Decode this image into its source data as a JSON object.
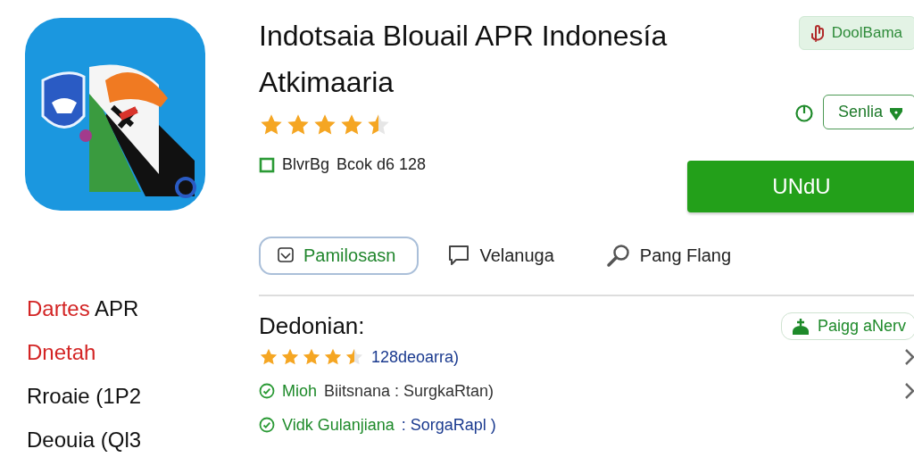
{
  "app": {
    "title": "Indotsaia Blouail APR Indonesía Atkimaaria",
    "stars": 4.5,
    "meta_label": "BlvrBg",
    "meta_value": "Bcok d6 128"
  },
  "badge": {
    "label": "DoolBama"
  },
  "secondary_button": {
    "label": "Senlia"
  },
  "primary_button": {
    "label": "UNdU"
  },
  "tabs": [
    {
      "label": "Pamilosasn",
      "selected": true
    },
    {
      "label": "Velanuga",
      "selected": false
    },
    {
      "label": "Pang Flang",
      "selected": false
    }
  ],
  "sidebar": {
    "items": [
      {
        "accent": "Dartes",
        "text": "APR"
      },
      {
        "accent": "Dnetah"
      },
      {
        "text": "Rroaie (1P2"
      },
      {
        "text": "Deouia (Ql3"
      }
    ]
  },
  "section": {
    "title": "Dedonian:",
    "action": "Paigg aNerv",
    "rows": [
      {
        "kind": "rating",
        "stars": 4.5,
        "value": "128deoarra)",
        "chevron": true
      },
      {
        "kind": "check",
        "label": "Mioh",
        "value": "Biitsnana : SurgkaRtan)",
        "link": false,
        "chevron": true
      },
      {
        "kind": "check",
        "label": "Vidk Gulanjiana",
        "value": ": SorgaRapl )",
        "link": true,
        "chevron": false
      }
    ]
  }
}
